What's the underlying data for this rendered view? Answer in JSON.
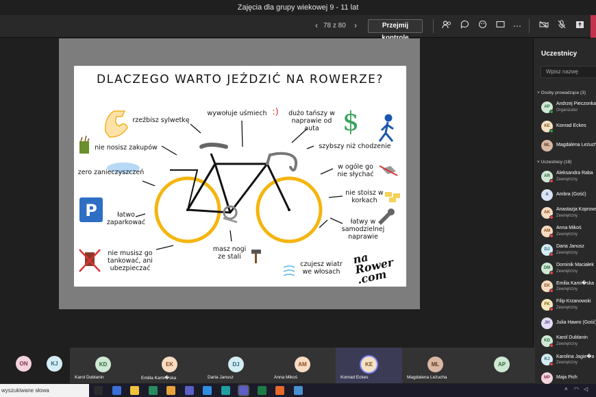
{
  "window_title": "Zajęcia dla grupy wiekowej 9 - 11 lat",
  "toolbar": {
    "prev_icon": "chevron-left-icon",
    "next_icon": "chevron-right-icon",
    "slide_counter": "78 z 80",
    "take_control_label": "Przejmij kontrolę",
    "icons": [
      "participants-icon",
      "chat-icon",
      "reactions-icon",
      "share-screen-icon",
      "more-icon",
      "camera-off-icon",
      "mic-off-icon",
      "share-tray-icon"
    ]
  },
  "slide": {
    "title": "DLACZEGO WARTO JEŹDZIĆ NA ROWERZE?",
    "labels": [
      "rzeźbisz sylwetkę",
      "wywołuje uśmiech",
      ":)",
      "dużo tańszy w naprawie od auta",
      "$",
      "nie nosisz zakupów",
      "szybszy niż chodzenie",
      "zero zanieczyszczeń",
      "w ogóle go nie słychać",
      "nie stoisz w korkach",
      "P",
      "łatwo zaparkować",
      "łatwy w samodzielnej naprawie",
      "nie musisz go tankować, ani ubezpieczać",
      "masz nogi ze stali",
      "czujesz wiatr we włosach"
    ],
    "logo_line1": "na",
    "logo_line2": "Rower",
    "logo_line3": ".com",
    "colors": {
      "wheel": "#f5b50f",
      "frame": "#111111",
      "dollar": "#3aa35a",
      "parking": "#2e6fc4",
      "walker": "#1a57b0"
    }
  },
  "panel": {
    "title": "Uczestnicy",
    "search_placeholder": "Wpisz nazwę",
    "presenters_header": "Osoby prowadzące (3)",
    "attendees_header": "Uczestnicy (18)",
    "presenters": [
      {
        "initials": "AP",
        "name": "Andrzej Pieczonka",
        "sub": "Organizator",
        "color": "#cfe8d4",
        "text": "#2c6a3c",
        "status": "#2ea043"
      },
      {
        "initials": "KE",
        "name": "Konrad Eckes",
        "sub": "",
        "color": "#f3e2c6",
        "text": "#7b5418",
        "status": "#2ea043"
      },
      {
        "initials": "ML",
        "name": "Magdalena Leżucha",
        "sub": "",
        "color": "#d9b8a3",
        "text": "#5a3322",
        "status": ""
      }
    ],
    "attendees": [
      {
        "initials": "AR",
        "name": "Aleksandra Raba",
        "sub": "Zewnętrzny",
        "color": "#cfe8d4",
        "text": "#2c6a3c",
        "status": "#e0474c"
      },
      {
        "initials": "A",
        "name": "Ambra (Gość)",
        "sub": "",
        "color": "#d9e4f5",
        "text": "#2c4a7a",
        "status": ""
      },
      {
        "initials": "AK",
        "name": "Anastazja Koprowska",
        "sub": "Zewnętrzny",
        "color": "#f7dcc3",
        "text": "#8a4b1a",
        "status": "#e0474c"
      },
      {
        "initials": "AM",
        "name": "Anna Mikoś",
        "sub": "Zewnętrzny",
        "color": "#f7dcc3",
        "text": "#8a4b1a",
        "status": "#e0474c"
      },
      {
        "initials": "DJ",
        "name": "Daria Janusz",
        "sub": "Zewnętrzny",
        "color": "#d4ecf3",
        "text": "#2a6577",
        "status": "#e0474c"
      },
      {
        "initials": "DM",
        "name": "Dominik Maciałek",
        "sub": "Zewnętrzny",
        "color": "#cfe8d4",
        "text": "#2c6a3c",
        "status": "#e0474c"
      },
      {
        "initials": "EK",
        "name": "Emilia Kami�ska",
        "sub": "Zewnętrzny",
        "color": "#f7dcc3",
        "text": "#8a4b1a",
        "status": "#e0474c"
      },
      {
        "initials": "FK",
        "name": "Filip Krzanowski",
        "sub": "Zewnętrzny",
        "color": "#f7e9bd",
        "text": "#7a5e12",
        "status": "#e0474c"
      },
      {
        "initials": "JH",
        "name": "Julia Hawro (Gość)",
        "sub": "",
        "color": "#e2dcf3",
        "text": "#4e3f86",
        "status": ""
      },
      {
        "initials": "KD",
        "name": "Karol Dublanin",
        "sub": "Zewnętrzny",
        "color": "#cfe8d4",
        "text": "#2c6a3c",
        "status": "#e0474c"
      },
      {
        "initials": "KJ",
        "name": "Karolina Jagie�a",
        "sub": "Zewnętrzny",
        "color": "#d4ecf3",
        "text": "#2a6577",
        "status": "#e0474c"
      },
      {
        "initials": "MP",
        "name": "Maja Pich",
        "sub": "",
        "color": "#f3d3dd",
        "text": "#86304c",
        "status": ""
      }
    ]
  },
  "strip": {
    "left_avatars": [
      {
        "initials": "ON",
        "color": "#f3d3dd",
        "text": "#86304c"
      },
      {
        "initials": "KJ",
        "color": "#d4ecf3",
        "text": "#2a6577"
      }
    ],
    "tiles": [
      {
        "initials": "KD",
        "name": "Karol Dublanin",
        "color": "#cfe8d4",
        "text": "#2c6a3c"
      },
      {
        "initials": "EK",
        "name": "Emilia Kami�ska",
        "color": "#f7dcc3",
        "text": "#8a4b1a"
      },
      {
        "initials": "DJ",
        "name": "Daria Janusz",
        "color": "#d4ecf3",
        "text": "#2a6577"
      },
      {
        "initials": "AM",
        "name": "Anna Mikoś",
        "color": "#f7dcc3",
        "text": "#8a4b1a"
      },
      {
        "initials": "KE",
        "name": "Konrad Eckes",
        "color": "#f3e2c6",
        "text": "#7b5418"
      },
      {
        "initials": "ML",
        "name": "Magdalena Leżucha",
        "color": "#d9b8a3",
        "text": "#5a3322"
      },
      {
        "initials": "AP",
        "name": "",
        "color": "#cfe8d4",
        "text": "#2c6a3c"
      }
    ]
  },
  "taskbar": {
    "search_text": "wyszukiwane słowa",
    "apps": [
      "task-view-icon",
      "widgets-icon",
      "file-explorer-icon",
      "paint-icon",
      "chrome-icon",
      "teams-icon",
      "vscode-icon",
      "edge-icon",
      "teams-active-icon",
      "excel-icon",
      "firefox-icon",
      "other-app-icon"
    ],
    "tray": [
      "chevron-up-icon",
      "wifi-icon",
      "volume-icon"
    ]
  }
}
